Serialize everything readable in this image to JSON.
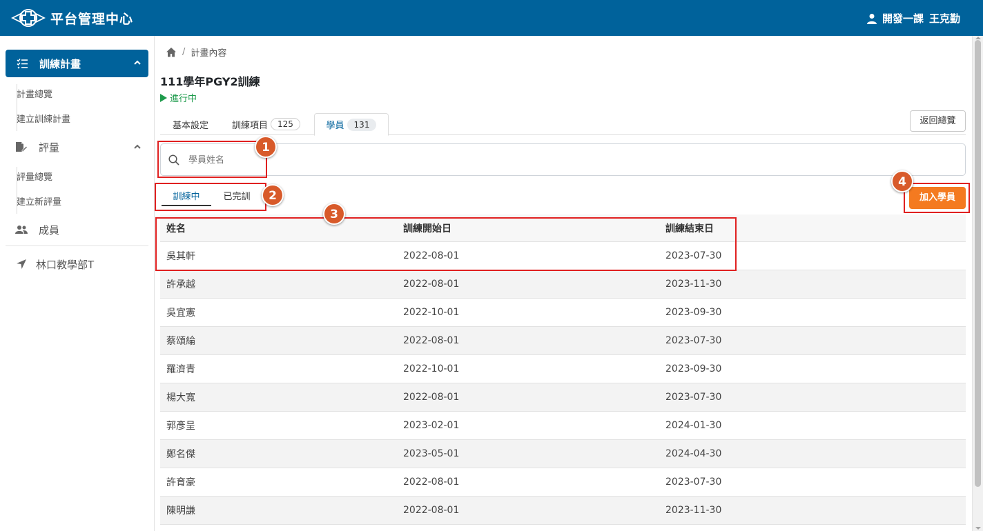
{
  "header": {
    "title": "平台管理中心",
    "user_dept": "開發一課",
    "user_name": "王克勤"
  },
  "sidebar": {
    "training_plan": {
      "label": "訓練計畫",
      "items": [
        "計畫總覽",
        "建立訓練計畫"
      ]
    },
    "evaluation": {
      "label": "評量",
      "items": [
        "評量總覽",
        "建立新評量"
      ]
    },
    "members": {
      "label": "成員"
    },
    "org": {
      "label": "林口教學部T"
    }
  },
  "breadcrumb": {
    "separator": "/",
    "current": "計畫內容"
  },
  "plan": {
    "title": "111學年PGY2訓練",
    "status": "進行中"
  },
  "tabs": [
    {
      "label": "基本設定",
      "count": null
    },
    {
      "label": "訓練項目",
      "count": "125"
    },
    {
      "label": "學員",
      "count": "131"
    }
  ],
  "back_button": "返回總覽",
  "search": {
    "placeholder": "學員姓名",
    "value": ""
  },
  "filter_tabs": [
    "訓練中",
    "已完訓"
  ],
  "add_button": "加入學員",
  "table": {
    "headers": [
      "姓名",
      "訓練開始日",
      "訓練結束日"
    ],
    "rows": [
      [
        "吳其軒",
        "2022-08-01",
        "2023-07-30"
      ],
      [
        "許承越",
        "2022-08-01",
        "2023-11-30"
      ],
      [
        "吳宜憲",
        "2022-10-01",
        "2023-09-30"
      ],
      [
        "蔡頌綸",
        "2022-08-01",
        "2023-07-30"
      ],
      [
        "羅濟青",
        "2022-10-01",
        "2023-09-30"
      ],
      [
        "楊大寬",
        "2022-08-01",
        "2023-07-30"
      ],
      [
        "郭彥呈",
        "2023-02-01",
        "2024-01-30"
      ],
      [
        "鄭名傑",
        "2023-05-01",
        "2024-04-30"
      ],
      [
        "許育豪",
        "2022-08-01",
        "2023-07-30"
      ],
      [
        "陳明謙",
        "2022-08-01",
        "2023-11-30"
      ]
    ]
  },
  "callouts": [
    "1",
    "2",
    "3",
    "4"
  ],
  "colors": {
    "primary": "#00629b",
    "accent": "#f47a20",
    "status": "#1e9b4c",
    "highlight": "#e02020",
    "marker": "#d85a2a"
  }
}
